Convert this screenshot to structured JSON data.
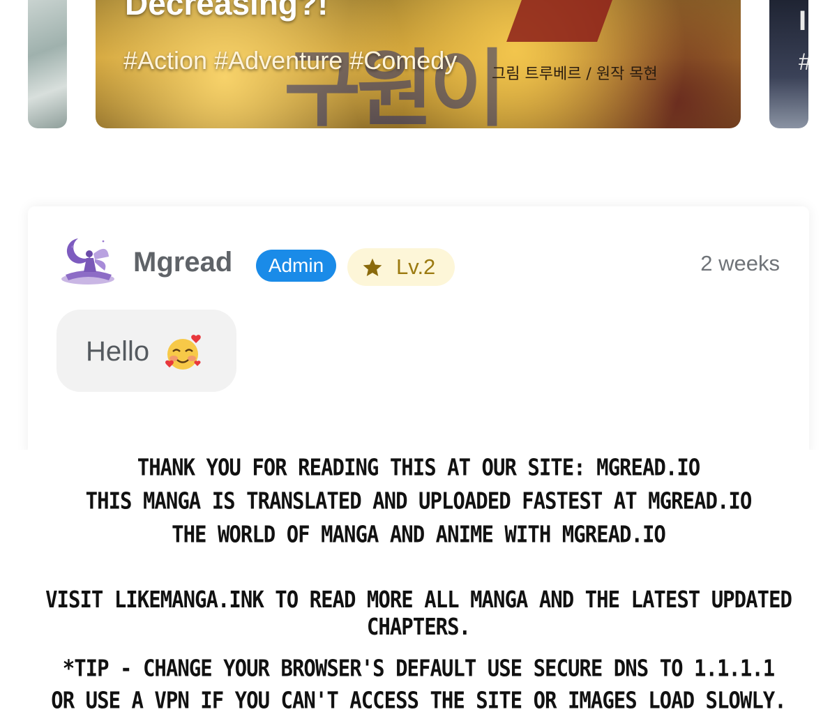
{
  "banner": {
    "title": "Decreasing?!",
    "tags": "#Action #Adventure #Comedy",
    "art_text": "구원이",
    "art_credit": "그림 트루베르 / 원작 목현",
    "right_card_tag": "#",
    "right_card_initial": "I"
  },
  "comment": {
    "username": "Mgread",
    "role_badge": "Admin",
    "level": "Lv.2",
    "time": "2 weeks",
    "message": "Hello",
    "emoji": "smiling-face-with-hearts-icon"
  },
  "notice": {
    "lines": [
      "THANK YOU FOR READING THIS AT OUR SITE: MGREAD.IO",
      "THIS MANGA IS TRANSLATED AND UPLOADED FASTEST AT MGREAD.IO",
      "THE WORLD OF MANGA AND ANIME WITH MGREAD.IO",
      "VISIT LIKEMANGA.INK TO READ MORE ALL MANGA AND THE LATEST UPDATED CHAPTERS.",
      "*TIP - CHANGE YOUR BROWSER'S DEFAULT USE SECURE DNS TO 1.1.1.1",
      "OR USE A VPN IF YOU CAN'T ACCESS THE SITE OR IMAGES LOAD SLOWLY."
    ]
  },
  "colors": {
    "admin_badge": "#1a8be8",
    "level_badge_bg": "#fdf6d8",
    "level_badge_text": "#9b7a10",
    "bubble_bg": "#f2f2f2"
  }
}
